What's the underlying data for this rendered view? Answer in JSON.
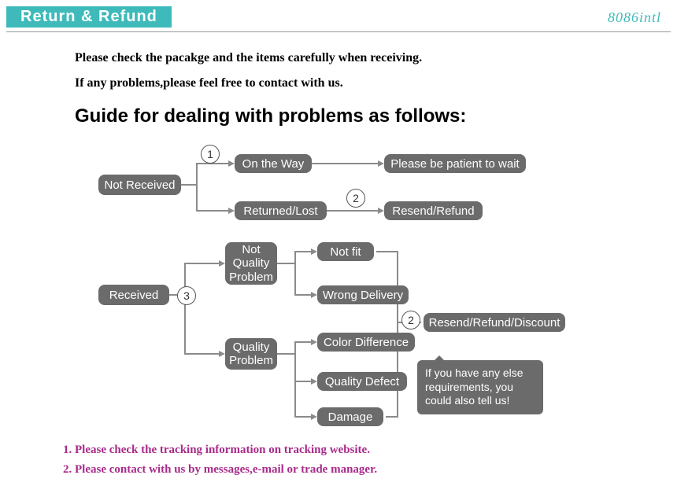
{
  "header": {
    "title": "Return & Refund",
    "brand": "8086intl"
  },
  "intro": {
    "line1": "Please check the pacakge and the items carefully when receiving.",
    "line2": "If any problems,please feel free to contact with us."
  },
  "guide_title": "Guide for dealing with problems as follows:",
  "nodes": {
    "not_received": "Not Received",
    "on_the_way": "On the Way",
    "returned_lost": "Returned/Lost",
    "patient": "Please be patient to wait",
    "resend_refund": "Resend/Refund",
    "received": "Received",
    "not_quality": "Not\nQuality\nProblem",
    "quality": "Quality\nProblem",
    "not_fit": "Not fit",
    "wrong_delivery": "Wrong Delivery",
    "color_diff": "Color Difference",
    "quality_defect": "Quality Defect",
    "damage": "Damage",
    "resend_refund_discount": "Resend/Refund/Discount",
    "speech": "If you have any else requirements, you could also tell us!"
  },
  "markers": {
    "m1": "1",
    "m2": "2",
    "m3": "3",
    "m2b": "2"
  },
  "footer": {
    "line1": "1. Please check the tracking information on tracking website.",
    "line2": "2. Please contact with us by messages,e-mail or trade manager."
  },
  "chart_data": {
    "type": "flowchart",
    "title": "Guide for dealing with problems",
    "nodes": [
      {
        "id": "not_received",
        "label": "Not Received"
      },
      {
        "id": "on_the_way",
        "label": "On the Way"
      },
      {
        "id": "returned_lost",
        "label": "Returned/Lost"
      },
      {
        "id": "patient",
        "label": "Please be patient to wait"
      },
      {
        "id": "resend_refund",
        "label": "Resend/Refund"
      },
      {
        "id": "received",
        "label": "Received"
      },
      {
        "id": "not_quality",
        "label": "Not Quality Problem"
      },
      {
        "id": "quality",
        "label": "Quality Problem"
      },
      {
        "id": "not_fit",
        "label": "Not fit"
      },
      {
        "id": "wrong_delivery",
        "label": "Wrong Delivery"
      },
      {
        "id": "color_diff",
        "label": "Color Difference"
      },
      {
        "id": "quality_defect",
        "label": "Quality Defect"
      },
      {
        "id": "damage",
        "label": "Damage"
      },
      {
        "id": "resend_refund_discount",
        "label": "Resend/Refund/Discount"
      }
    ],
    "edges": [
      {
        "from": "not_received",
        "to": "on_the_way",
        "label": "1"
      },
      {
        "from": "not_received",
        "to": "returned_lost"
      },
      {
        "from": "on_the_way",
        "to": "patient"
      },
      {
        "from": "returned_lost",
        "to": "resend_refund",
        "label": "2"
      },
      {
        "from": "received",
        "to": "not_quality",
        "label": "3"
      },
      {
        "from": "received",
        "to": "quality"
      },
      {
        "from": "not_quality",
        "to": "not_fit"
      },
      {
        "from": "not_quality",
        "to": "wrong_delivery"
      },
      {
        "from": "quality",
        "to": "color_diff"
      },
      {
        "from": "quality",
        "to": "quality_defect"
      },
      {
        "from": "quality",
        "to": "damage"
      },
      {
        "from": "not_fit",
        "to": "resend_refund_discount",
        "label": "2"
      },
      {
        "from": "wrong_delivery",
        "to": "resend_refund_discount"
      },
      {
        "from": "color_diff",
        "to": "resend_refund_discount"
      },
      {
        "from": "quality_defect",
        "to": "resend_refund_discount"
      },
      {
        "from": "damage",
        "to": "resend_refund_discount"
      }
    ],
    "annotations": [
      "If you have any else requirements, you could also tell us!"
    ]
  }
}
